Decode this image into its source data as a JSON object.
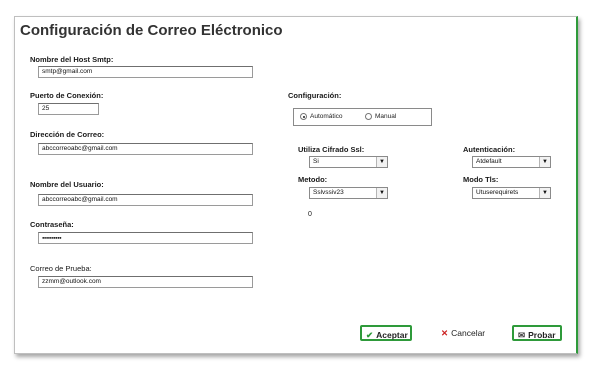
{
  "page": {
    "title": "Configuración de Correo Eléctronico"
  },
  "host": {
    "label": "Nombre del Host Smtp:",
    "value": "smtp@gmail.com"
  },
  "port": {
    "label": "Puerto de Conexión:",
    "value": "25"
  },
  "email": {
    "label": "Dirección de Correo:",
    "value": "abccorreoabc@gmail.com"
  },
  "user": {
    "label": "Nombre del Usuario:",
    "value": "abccorreoabc@gmail.com"
  },
  "password": {
    "label": "Contraseña:",
    "value": "●●●●●●●●●●"
  },
  "test_email": {
    "label": "Correo de Prueba:",
    "value": "zzmm@outlook.com"
  },
  "config": {
    "label": "Configuración:",
    "automatic": "Automático",
    "manual": "Manual",
    "selected": "automatic"
  },
  "ssl": {
    "label": "Utiliza Cifrado Ssl:",
    "value": "Si"
  },
  "auth": {
    "label": "Autenticación:",
    "value": "Atdefault"
  },
  "method": {
    "label": "Metodo:",
    "value": "Sslvssiv23"
  },
  "tls": {
    "label": "Modo Tls:",
    "value": "Utuserequirets"
  },
  "status_value": "0",
  "buttons": {
    "accept": "Aceptar",
    "cancel": "Cancelar",
    "test": "Probar"
  },
  "icons": {
    "accept": "check-icon",
    "cancel": "x-icon",
    "test": "send-mail-icon"
  },
  "colors": {
    "accent": "#2e9a3a",
    "cancel": "#cc2222"
  }
}
